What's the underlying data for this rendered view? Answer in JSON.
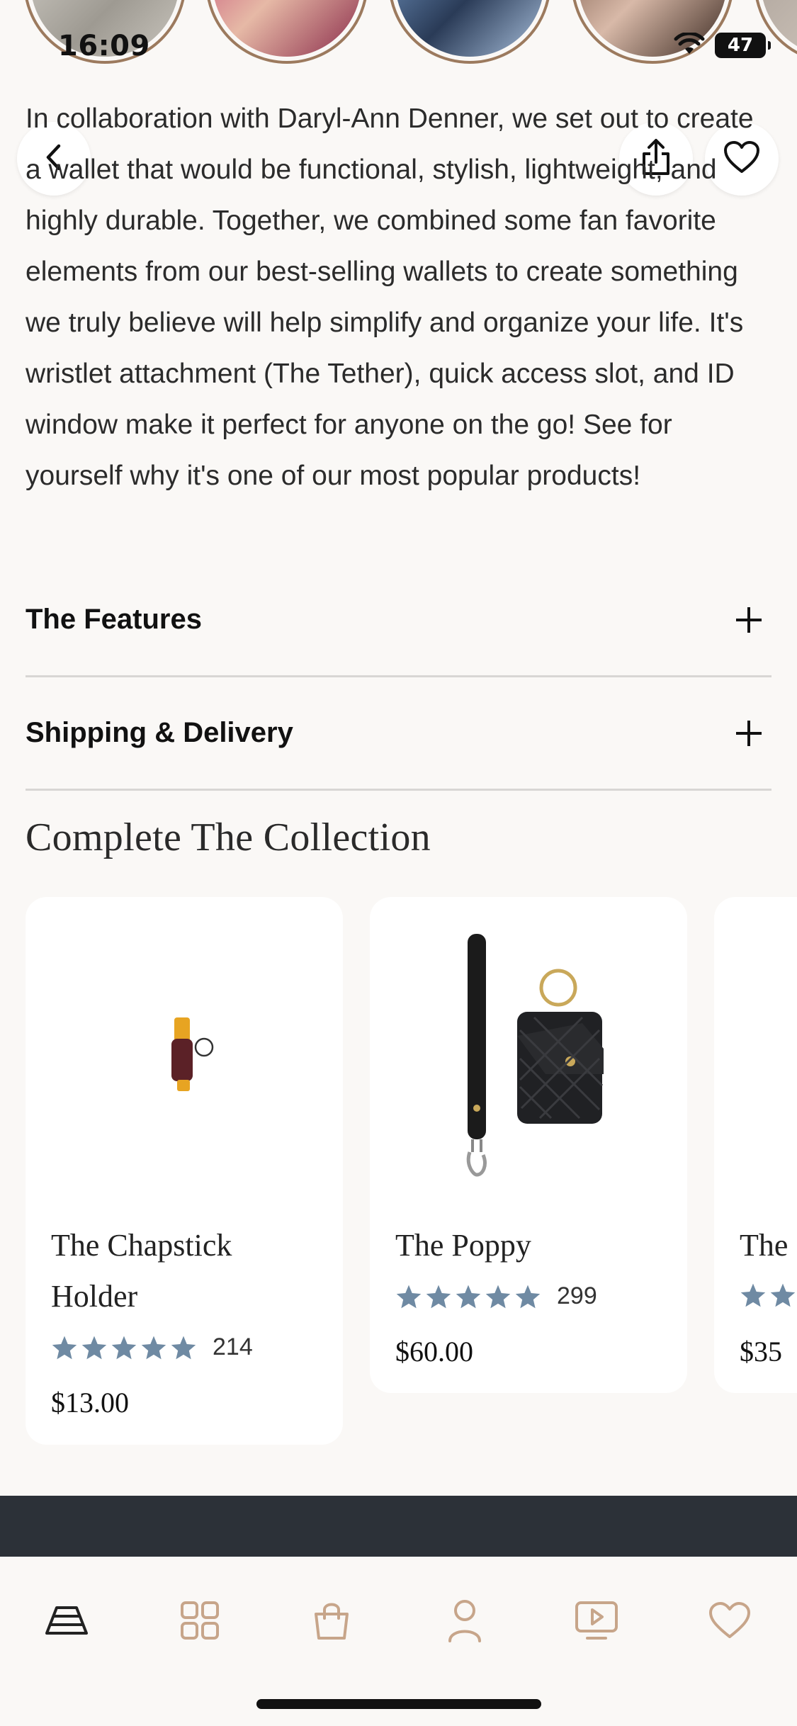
{
  "status_bar": {
    "time": "16:09",
    "battery": "47"
  },
  "description": "In collaboration with Daryl-Ann Denner, we set out to create a wallet that would be functional, stylish, lightweight, and highly durable. Together, we combined some fan favorite elements from our best-selling wallets to create something we truly believe will help simplify and organize your life. It's wristlet attachment (The Tether), quick access slot, and ID window make it perfect for anyone on the go! See for yourself why it's one of our most popular products!",
  "accordions": [
    {
      "label": "The Features"
    },
    {
      "label": "Shipping & Delivery"
    }
  ],
  "collection": {
    "title": "Complete The Collection",
    "products": [
      {
        "name_line1": "The Chapstick",
        "name_line2": "Holder",
        "reviews": "214",
        "price": "$13.00",
        "rating": 5
      },
      {
        "name_line1": "The Poppy",
        "name_line2": "",
        "reviews": "299",
        "price": "$60.00",
        "rating": 5
      },
      {
        "name_line1": "The",
        "name_line2": "",
        "reviews": "",
        "price": "$35",
        "rating": 5
      }
    ]
  },
  "colors": {
    "accent": "#9c7a5e",
    "star": "#6f8aa3",
    "tab_icon": "#c7a58a",
    "dark_band": "#2c3138"
  }
}
